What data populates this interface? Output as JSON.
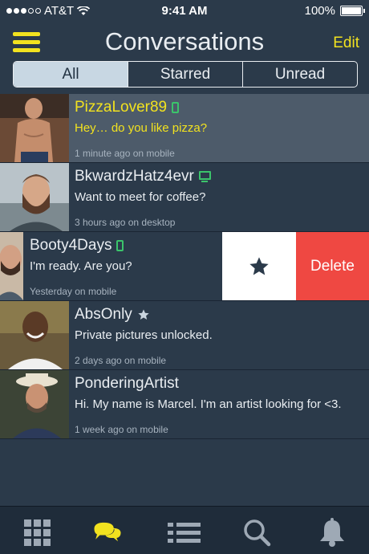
{
  "status_bar": {
    "carrier": "AT&T",
    "time": "9:41 AM",
    "battery": "100%"
  },
  "nav": {
    "title": "Conversations",
    "edit_label": "Edit"
  },
  "filters": {
    "all": "All",
    "starred": "Starred",
    "unread": "Unread",
    "selected": "All"
  },
  "conversations": [
    {
      "name": "PizzaLover89",
      "message": "Hey… do you like pizza?",
      "meta": "1 minute ago on mobile",
      "device": "mobile-icon"
    },
    {
      "name": "BkwardzHatz4evr",
      "message": "Want to meet for coffee?",
      "meta": "3 hours ago on desktop",
      "device": "desktop-icon"
    },
    {
      "name": "Booty4Days",
      "message": "I'm ready. Are you?",
      "meta": "Yesterday on mobile",
      "device": "mobile-icon"
    },
    {
      "name": "AbsOnly",
      "message": "Private pictures unlocked.",
      "meta": "2 days ago on mobile",
      "device": "star-icon"
    },
    {
      "name": "PonderingArtist",
      "message": "Hi. My name is Marcel. I'm an artist looking for <3.",
      "meta": "1 week ago on mobile",
      "device": ""
    }
  ],
  "swipe_actions": {
    "delete_label": "Delete"
  },
  "colors": {
    "background": "#2b3a4a",
    "accent": "#f2e21f",
    "online": "#3bc46b",
    "delete": "#ef4842"
  },
  "tab_bar": [
    "grid-icon",
    "chat-bubbles-icon",
    "list-icon",
    "search-icon",
    "bell-icon"
  ]
}
